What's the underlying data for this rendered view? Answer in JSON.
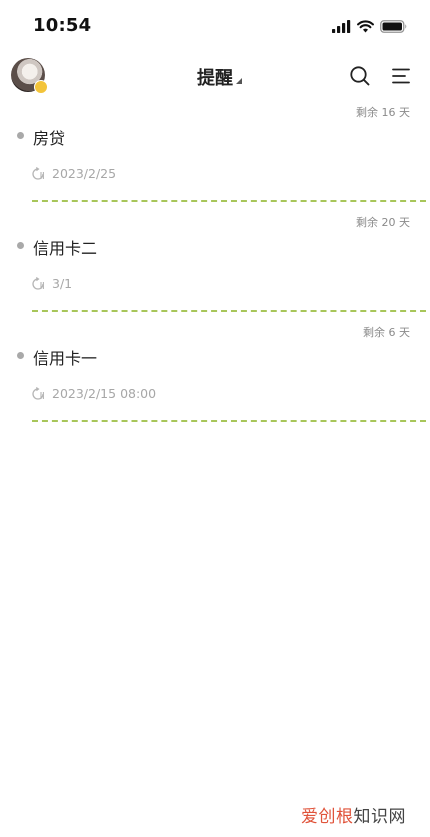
{
  "status_bar": {
    "time": "10:54"
  },
  "header": {
    "title": "提醒"
  },
  "reminders": [
    {
      "title": "房贷",
      "date": "2023/2/25",
      "remaining": "剩余 16 天"
    },
    {
      "title": "信用卡二",
      "date": "3/1",
      "remaining": "剩余 20 天"
    },
    {
      "title": "信用卡一",
      "date": "2023/2/15 08:00",
      "remaining": "剩余 6 天"
    }
  ],
  "watermark": {
    "accent_text": "爱创根",
    "text": "知识网"
  },
  "colors": {
    "divider": "#a8c65a",
    "muted_text": "#a7a7a7",
    "bullet": "#a9a9a9",
    "avatar_badge": "#f3c43a"
  },
  "icons": {
    "header": [
      "avatar",
      "chevron-down-icon",
      "search-icon",
      "menu-icon"
    ],
    "status": [
      "signal-icon",
      "wifi-icon",
      "battery-icon"
    ],
    "item": "repeat-icon"
  }
}
